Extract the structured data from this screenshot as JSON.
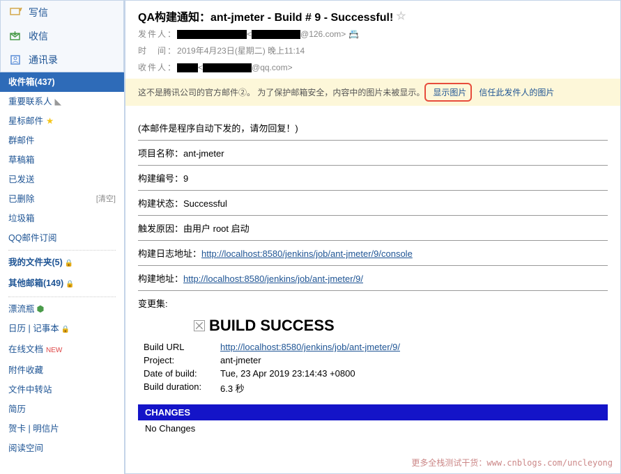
{
  "compose": {
    "write": "写信",
    "receive": "收信",
    "contacts": "通讯录"
  },
  "folders": {
    "inbox": "收件箱(437)",
    "important": "重要联系人",
    "starred": "星标邮件",
    "group": "群邮件",
    "drafts": "草稿箱",
    "sent": "已发送",
    "deleted": "已删除",
    "clear": "[清空]",
    "spam": "垃圾箱",
    "subscription": "QQ邮件订阅",
    "myfolder": "我的文件夹(5)",
    "othermail": "其他邮箱(149)",
    "bottle": "漂流瓶",
    "calendar": "日历",
    "notepad": "记事本",
    "onlinedoc": "在线文档",
    "attach": "附件收藏",
    "filestation": "文件中转站",
    "resume": "简历",
    "card": "贺卡",
    "postcard": "明信片",
    "readspace": "阅读空间"
  },
  "mail": {
    "subject": "QA构建通知：ant-jmeter - Build # 9 - Successful!",
    "from_label": "发件人：",
    "from_domain": "@126.com>",
    "time_label": "时　间：",
    "time_value": "2019年4月23日(星期二) 晚上11:14",
    "to_label": "收件人：",
    "to_domain": "@qq.com>"
  },
  "notice": {
    "text": "这不是腾讯公司的官方邮件②。 为了保护邮箱安全，内容中的图片未被显示。",
    "show_images": "显示图片",
    "trust_sender": "信任此发件人的图片"
  },
  "body": {
    "intro": "(本邮件是程序自动下发的，请勿回复！)",
    "project_label": "项目名称：ant-jmeter",
    "build_no_label": "构建编号：9",
    "build_status_label": "构建状态：Successful",
    "trigger_label": "触发原因：由用户 root 启动",
    "log_label": "构建日志地址：",
    "log_url": "http://localhost:8580/jenkins/job/ant-jmeter/9/console",
    "build_url_label": "构建地址：",
    "build_url": "http://localhost:8580/jenkins/job/ant-jmeter/9/",
    "changeset": "变更集:",
    "build_success": "BUILD SUCCESS",
    "table": {
      "build_url_k": "Build URL",
      "build_url_v": "http://localhost:8580/jenkins/job/ant-jmeter/9/",
      "project_k": "Project:",
      "project_v": "ant-jmeter",
      "date_k": "Date of build:",
      "date_v": "Tue, 23 Apr 2019 23:14:43 +0800",
      "duration_k": "Build duration:",
      "duration_v": "6.3 秒"
    },
    "changes_header": "CHANGES",
    "no_changes": "No Changes"
  },
  "watermark": "更多全栈测试干货：www.cnblogs.com/uncleyong"
}
